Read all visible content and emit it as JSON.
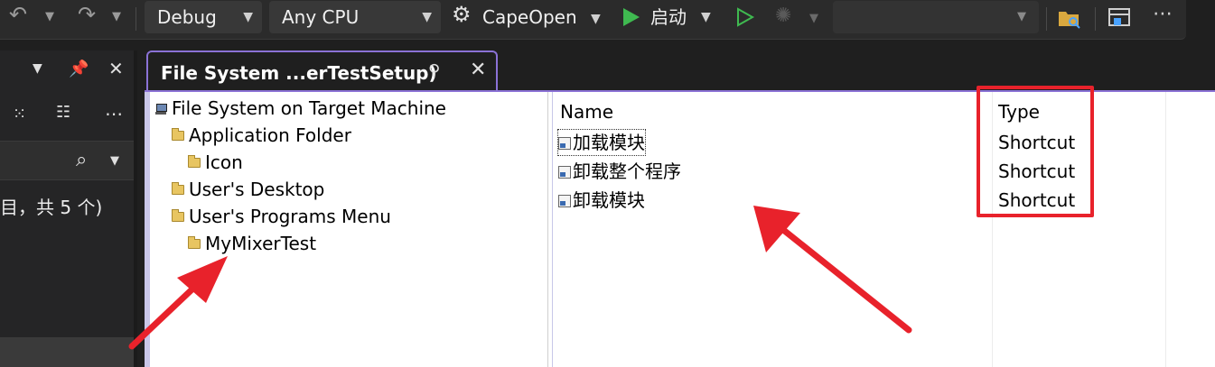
{
  "toolbar": {
    "configuration": "Debug",
    "platform": "Any CPU",
    "project": "CapeOpen",
    "start_label": "启动",
    "icons": [
      "undo-icon",
      "redo-icon",
      "gear-icon",
      "play-icon",
      "play-outline-icon",
      "hot-reload-icon",
      "folder-search-icon",
      "window-icon",
      "more-icon"
    ]
  },
  "left_panel": {
    "status_text": "目，共 5 个)"
  },
  "document_tab": {
    "title": "File System ...erTestSetup)"
  },
  "tree": {
    "root": "File System on Target Machine",
    "items": [
      {
        "label": "Application Folder"
      },
      {
        "label": "Icon"
      },
      {
        "label": "User's Desktop"
      },
      {
        "label": "User's Programs Menu"
      },
      {
        "label": "MyMixerTest"
      }
    ]
  },
  "list": {
    "columns": [
      "Name",
      "Type"
    ],
    "rows": [
      {
        "name": "加载模块",
        "type": "Shortcut"
      },
      {
        "name": "卸载整个程序",
        "type": "Shortcut"
      },
      {
        "name": "卸载模块",
        "type": "Shortcut"
      }
    ]
  },
  "colors": {
    "annotation": "#e8222b",
    "tab_accent": "#8b72d6",
    "ide_background": "#1f1f1f",
    "play_green": "#3fb950"
  }
}
